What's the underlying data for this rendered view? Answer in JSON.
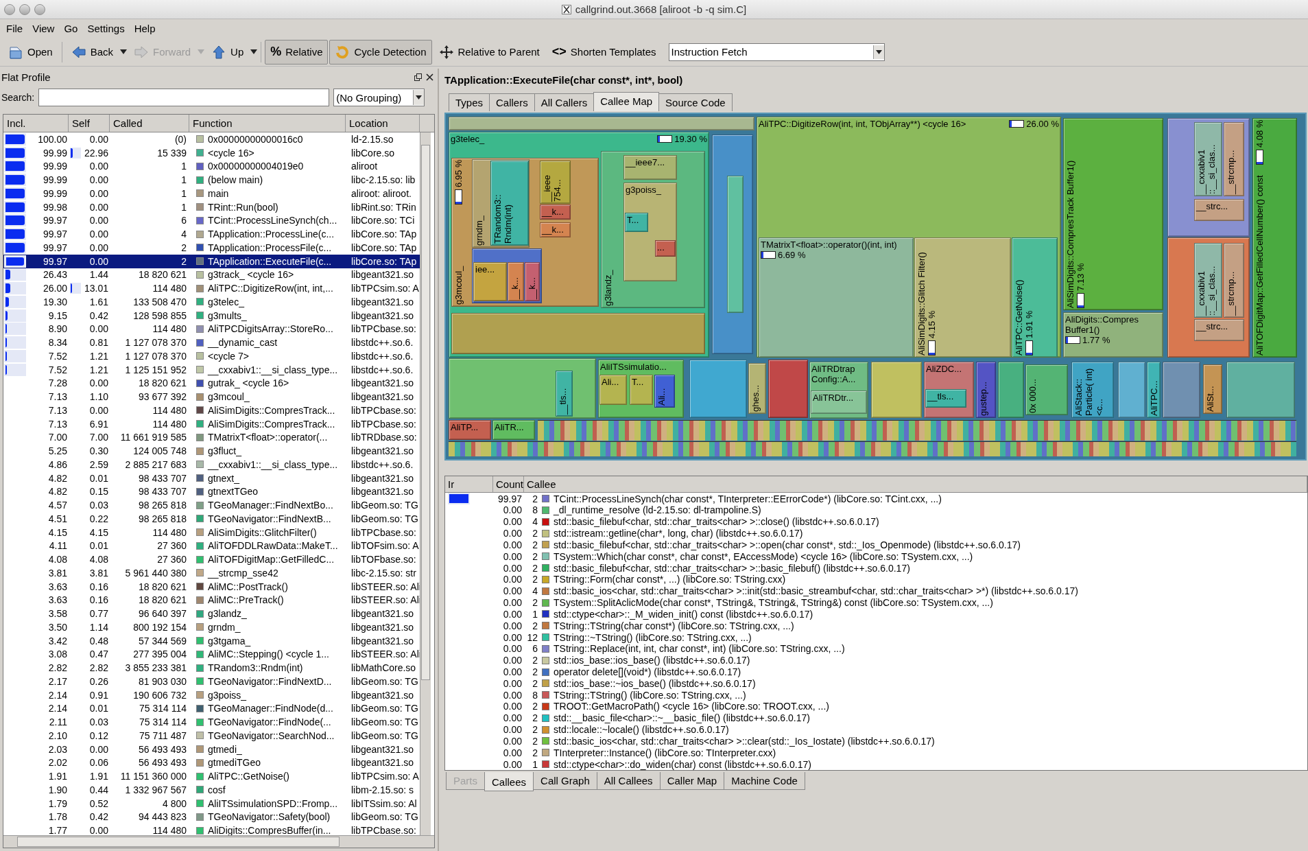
{
  "window": {
    "title": "callgrind.out.3668 [aliroot -b -q sim.C]"
  },
  "menu": [
    "File",
    "View",
    "Go",
    "Settings",
    "Help"
  ],
  "toolbar": {
    "buttons": [
      {
        "label": "Open",
        "kind": "button",
        "disabled": false,
        "checked": false
      },
      {
        "label": "Back",
        "kind": "nav",
        "disabled": false,
        "checked": false
      },
      {
        "label": "Forward",
        "kind": "nav",
        "disabled": true,
        "checked": false
      },
      {
        "label": "Up",
        "kind": "nav",
        "disabled": false,
        "checked": false
      },
      {
        "label": "Relative",
        "kind": "toggle",
        "icon_text": "%",
        "disabled": false,
        "checked": true
      },
      {
        "label": "Cycle Detection",
        "kind": "toggle",
        "disabled": false,
        "checked": true
      },
      {
        "label": "Relative to Parent",
        "kind": "toggle",
        "disabled": false,
        "checked": false
      },
      {
        "label": "Shorten Templates",
        "kind": "toggle",
        "icon_text": "<>",
        "disabled": false,
        "checked": false
      }
    ],
    "event_type": "Instruction Fetch"
  },
  "flat_profile": {
    "title": "Flat Profile",
    "search_label": "Search:",
    "grouping": "(No Grouping)",
    "columns": [
      "Incl.",
      "Self",
      "Called",
      "Function",
      "Location"
    ],
    "rows": [
      {
        "incl": "100.00",
        "level": 1.0,
        "self": "0.00",
        "called": "(0)",
        "function": "0x00000000000016c0",
        "location": "ld-2.15.so",
        "color": "#b8c0a0",
        "selected": false
      },
      {
        "incl": "99.99",
        "level": 0.9999,
        "self": "22.96",
        "self_meter": {
          "level": 0.2296
        },
        "called": "15 339",
        "function": "<cycle 16>",
        "location": "libCore.so",
        "color": "#40b090",
        "selected": false
      },
      {
        "incl": "99.99",
        "level": 0.9999,
        "self": "0.00",
        "called": "1",
        "function": "0x00000000004019e0",
        "location": "aliroot",
        "color": "#6060c0",
        "selected": false
      },
      {
        "incl": "99.99",
        "level": 0.9999,
        "self": "0.00",
        "called": "1",
        "function": "(below main)",
        "location": "libc-2.15.so: lib",
        "color": "#30b080",
        "selected": false
      },
      {
        "incl": "99.99",
        "level": 0.9999,
        "self": "0.00",
        "called": "1",
        "function": "main",
        "location": "aliroot: aliroot.",
        "color": "#a89880",
        "selected": false
      },
      {
        "incl": "99.98",
        "level": 0.9998,
        "self": "0.00",
        "called": "1",
        "function": "TRint::Run(bool)",
        "location": "libRint.so: TRin",
        "color": "#a09080",
        "selected": false
      },
      {
        "incl": "99.97",
        "level": 0.9997,
        "self": "0.00",
        "called": "6",
        "function": "TCint::ProcessLineSynch(ch...",
        "location": "libCore.so: TCi",
        "color": "#6868c8",
        "selected": false
      },
      {
        "incl": "99.97",
        "level": 0.9997,
        "self": "0.00",
        "called": "4",
        "function": "TApplication::ProcessLine(c...",
        "location": "libCore.so: TAp",
        "color": "#b0a890",
        "selected": false
      },
      {
        "incl": "99.97",
        "level": 0.9997,
        "self": "0.00",
        "called": "2",
        "function": "TApplication::ProcessFile(c...",
        "location": "libCore.so: TAp",
        "color": "#3050b0",
        "selected": false
      },
      {
        "incl": "99.97",
        "level": 0.9997,
        "self": "0.00",
        "called": "2",
        "function": "TApplication::ExecuteFile(c...",
        "location": "libCore.so: TAp",
        "color": "#607080",
        "selected": true
      },
      {
        "incl": "26.43",
        "level": 0.2643,
        "self": "1.44",
        "called": "18 820 621",
        "function": "g3track_ <cycle 16>",
        "location": "libgeant321.so",
        "color": "#b8c0a0",
        "selected": false
      },
      {
        "incl": "26.00",
        "level": 0.26,
        "self": "13.01",
        "self_meter": {
          "level": 0.1301
        },
        "called": "114 480",
        "function": "AliTPC::DigitizeRow(int, int,...",
        "location": "libTPCsim.so: A",
        "color": "#a09078",
        "selected": false
      },
      {
        "incl": "19.30",
        "level": 0.193,
        "self": "1.61",
        "called": "133 508 470",
        "function": "g3telec_",
        "location": "libgeant321.so",
        "color": "#30b080",
        "selected": false
      },
      {
        "incl": "9.15",
        "level": 0.0915,
        "self": "0.42",
        "called": "128 598 855",
        "function": "g3mults_",
        "location": "libgeant321.so",
        "color": "#30b080",
        "selected": false
      },
      {
        "incl": "8.90",
        "level": 0.089,
        "self": "0.00",
        "called": "114 480",
        "function": "AliTPCDigitsArray::StoreRo...",
        "location": "libTPCbase.so:",
        "color": "#9090b0",
        "selected": false
      },
      {
        "incl": "8.34",
        "level": 0.0834,
        "self": "0.81",
        "called": "1 127 078 370",
        "function": "__dynamic_cast",
        "location": "libstdc++.so.6.",
        "color": "#5060c0",
        "selected": false
      },
      {
        "incl": "7.52",
        "level": 0.0752,
        "self": "1.21",
        "called": "1 127 078 370",
        "function": "<cycle 7>",
        "location": "libstdc++.so.6.",
        "color": "#b8c0a0",
        "selected": false
      },
      {
        "incl": "7.52",
        "level": 0.0752,
        "self": "1.21",
        "called": "1 125 151 952",
        "function": "__cxxabiv1::__si_class_type...",
        "location": "libstdc++.so.6.",
        "color": "#c0c8a8",
        "selected": false
      },
      {
        "incl": "7.28",
        "self": "0.00",
        "called": "18 820 621",
        "function": "gutrak_ <cycle 16>",
        "location": "libgeant321.so",
        "color": "#4050b0",
        "selected": false
      },
      {
        "incl": "7.13",
        "self": "1.10",
        "called": "93 677 392",
        "function": "g3mcoul_",
        "location": "libgeant321.so",
        "color": "#a89070",
        "selected": false
      },
      {
        "incl": "7.13",
        "self": "0.00",
        "called": "114 480",
        "function": "AliSimDigits::CompresTrack...",
        "location": "libTPCbase.so:",
        "color": "#604848",
        "selected": false
      },
      {
        "incl": "7.13",
        "self": "6.91",
        "called": "114 480",
        "function": "AliSimDigits::CompresTrack...",
        "location": "libTPCbase.so:",
        "color": "#30b080",
        "selected": false
      },
      {
        "incl": "7.00",
        "self": "7.00",
        "called": "11 661 919 585",
        "function": "TMatrixT<float>::operator(...",
        "location": "libTRDbase.so:",
        "color": "#809880",
        "selected": false
      },
      {
        "incl": "5.25",
        "self": "0.30",
        "called": "124 005 748",
        "function": "g3fluct_",
        "location": "libgeant321.so",
        "color": "#b09878",
        "selected": false
      },
      {
        "incl": "4.86",
        "self": "2.59",
        "called": "2 885 217 683",
        "function": "__cxxabiv1::__si_class_type...",
        "location": "libstdc++.so.6.",
        "color": "#a8b8a8",
        "selected": false
      },
      {
        "incl": "4.82",
        "self": "0.01",
        "called": "98 433 707",
        "function": "gtnext_",
        "location": "libgeant321.so",
        "color": "#506080",
        "selected": false
      },
      {
        "incl": "4.82",
        "self": "0.15",
        "called": "98 433 707",
        "function": "gtnextTGeo",
        "location": "libgeant321.so",
        "color": "#506080",
        "selected": false
      },
      {
        "incl": "4.57",
        "self": "0.03",
        "called": "98 265 818",
        "function": "TGeoManager::FindNextBo...",
        "location": "libGeom.so: TG",
        "color": "#80a088",
        "selected": false
      },
      {
        "incl": "4.51",
        "self": "0.22",
        "called": "98 265 818",
        "function": "TGeoNavigator::FindNextB...",
        "location": "libGeom.so: TG",
        "color": "#30a878",
        "selected": false
      },
      {
        "incl": "4.15",
        "self": "4.15",
        "called": "114 480",
        "function": "AliSimDigits::GlitchFilter()",
        "location": "libTPCbase.so:",
        "color": "#b8a080",
        "selected": false
      },
      {
        "incl": "4.11",
        "self": "0.01",
        "called": "27 360",
        "function": "AliTOFDDLRawData::MakeT...",
        "location": "libTOFsim.so: A",
        "color": "#30b080",
        "selected": false
      },
      {
        "incl": "4.08",
        "self": "4.08",
        "called": "27 360",
        "function": "AliTOFDigitMap::GetFilledC...",
        "location": "libTOFbase.so:",
        "color": "#30c070",
        "selected": false
      },
      {
        "incl": "3.81",
        "self": "3.81",
        "called": "5 961 440 380",
        "function": "__strcmp_sse42",
        "location": "libc-2.15.so: str",
        "color": "#c0a888",
        "selected": false
      },
      {
        "incl": "3.63",
        "self": "0.16",
        "called": "18 820 621",
        "function": "AliMC::PostTrack()",
        "location": "libSTEER.so: Ali",
        "color": "#604840",
        "selected": false
      },
      {
        "incl": "3.63",
        "self": "0.16",
        "called": "18 820 621",
        "function": "AliMC::PreTrack()",
        "location": "libSTEER.so: Ali",
        "color": "#a08870",
        "selected": false
      },
      {
        "incl": "3.58",
        "self": "0.77",
        "called": "96 640 397",
        "function": "g3landz_",
        "location": "libgeant321.so",
        "color": "#30a880",
        "selected": false
      },
      {
        "incl": "3.50",
        "self": "1.14",
        "called": "800 192 154",
        "function": "grndm_",
        "location": "libgeant321.so",
        "color": "#b8a080",
        "selected": false
      },
      {
        "incl": "3.42",
        "self": "0.48",
        "called": "57 344 569",
        "function": "g3tgama_",
        "location": "libgeant321.so",
        "color": "#30c070",
        "selected": false
      },
      {
        "incl": "3.08",
        "self": "0.47",
        "called": "277 395 004",
        "function": "AliMC::Stepping() <cycle 1...",
        "location": "libSTEER.so: Ali",
        "color": "#30b878",
        "selected": false
      },
      {
        "incl": "2.82",
        "self": "2.82",
        "called": "3 855 233 381",
        "function": "TRandom3::Rndm(int)",
        "location": "libMathCore.so",
        "color": "#30b080",
        "selected": false
      },
      {
        "incl": "2.17",
        "self": "0.26",
        "called": "81 903 030",
        "function": "TGeoNavigator::FindNextD...",
        "location": "libGeom.so: TG",
        "color": "#30c070",
        "selected": false
      },
      {
        "incl": "2.14",
        "self": "0.91",
        "called": "190 606 732",
        "function": "g3poiss_",
        "location": "libgeant321.so",
        "color": "#b8a080",
        "selected": false
      },
      {
        "incl": "2.14",
        "self": "0.01",
        "called": "75 314 114",
        "function": "TGeoManager::FindNode(d...",
        "location": "libGeom.so: TG",
        "color": "#406070",
        "selected": false
      },
      {
        "incl": "2.11",
        "self": "0.03",
        "called": "75 314 114",
        "function": "TGeoNavigator::FindNode(...",
        "location": "libGeom.so: TG",
        "color": "#30c070",
        "selected": false
      },
      {
        "incl": "2.10",
        "self": "0.12",
        "called": "75 711 487",
        "function": "TGeoNavigator::SearchNod...",
        "location": "libGeom.so: TG",
        "color": "#c0c0a8",
        "selected": false
      },
      {
        "incl": "2.03",
        "self": "0.00",
        "called": "56 493 493",
        "function": "gtmedi_",
        "location": "libgeant321.so",
        "color": "#b09878",
        "selected": false
      },
      {
        "incl": "2.02",
        "self": "0.06",
        "called": "56 493 493",
        "function": "gtmediTGeo",
        "location": "libgeant321.so",
        "color": "#b09878",
        "selected": false
      },
      {
        "incl": "1.91",
        "self": "1.91",
        "called": "11 151 360 000",
        "function": "AliTPC::GetNoise()",
        "location": "libTPCsim.so: A",
        "color": "#30c070",
        "selected": false
      },
      {
        "incl": "1.90",
        "self": "0.44",
        "called": "1 332 967 567",
        "function": "cosf",
        "location": "libm-2.15.so: s",
        "color": "#30a878",
        "selected": false
      },
      {
        "incl": "1.79",
        "self": "0.52",
        "called": "4 800",
        "function": "AliITSsimulationSPD::Fromp...",
        "location": "libITSsim.so: Al",
        "color": "#30c070",
        "selected": false
      },
      {
        "incl": "1.78",
        "self": "0.42",
        "called": "94 443 823",
        "function": "TGeoNavigator::Safety(bool)",
        "location": "libGeom.so: TG",
        "color": "#809888",
        "selected": false
      },
      {
        "incl": "1.77",
        "self": "0.00",
        "called": "114 480",
        "function": "AliDigits::CompresBuffer(in...",
        "location": "libTPCbase.so:",
        "color": "#30c070",
        "selected": false
      }
    ]
  },
  "detail": {
    "title": "TApplication::ExecuteFile(char const*, int*, bool)",
    "tabs": [
      {
        "label": "Types",
        "selected": false
      },
      {
        "label": "Callers",
        "selected": false
      },
      {
        "label": "All Callers",
        "selected": false
      },
      {
        "label": "Callee Map",
        "selected": true
      },
      {
        "label": "Source Code",
        "selected": false
      }
    ],
    "callee_map": {
      "nodes": [
        {
          "label": "g3telec_",
          "percent": "19.30 %",
          "kind": "horizontal",
          "color": "#3cb88c",
          "children": [
            {
              "label": "g3mcoul_",
              "percent": "6.95 %",
              "kind": "vertical",
              "color": "#c09858",
              "children": [
                {
                  "label": "grndm_",
                  "kind": "vertical",
                  "color": "#b4a470",
                  "children": [
                    {
                      "label": "TRandom3:: Rndm(int)",
                      "kind": "vertical",
                      "color": "#40b4a4"
                    }
                  ]
                },
                {
                  "label": "__ieee 754...",
                  "kind": "vertical",
                  "color": "#b4a840"
                },
                {
                  "label": "__k...",
                  "kind": "horizontal",
                  "color": "#c46050"
                },
                {
                  "label": "__k...",
                  "kind": "horizontal",
                  "color": "#d48450"
                },
                {
                  "color": "#5070c8",
                  "children": [
                    {
                      "label": "iee...",
                      "kind": "horizontal",
                      "color": "#c4a440"
                    },
                    {
                      "label": "__k...",
                      "kind": "vertical",
                      "color": "#d48450"
                    },
                    {
                      "label": "__k...",
                      "kind": "vertical",
                      "color": "#c46070"
                    }
                  ]
                }
              ]
            },
            {
              "label": "g3landz_",
              "kind": "vertical",
              "color": "#5cb880",
              "children": [
                {
                  "label": "__ieee7...",
                  "kind": "horizontal",
                  "color": "#a8b470"
                },
                {
                  "label": "g3poiss_",
                  "kind": "horizontal",
                  "color": "#b8b474",
                  "children": [
                    {
                      "label": "T...",
                      "kind": "horizontal",
                      "color": "#40b4a4"
                    },
                    {
                      "label": "...",
                      "kind": "horizontal",
                      "color": "#c46050"
                    }
                  ]
                }
              ]
            },
            {
              "color": "#b0a050"
            }
          ]
        },
        {
          "color": "#a8b890"
        },
        {
          "color": "#4890c8",
          "children": [
            {
              "color": "#60c0a0"
            }
          ]
        },
        {
          "label": "AliTPC::DigitizeRow(int, int, TObjArray**) <cycle 16>",
          "percent": "26.00 %",
          "kind": "horizontal",
          "color": "#8cba5c",
          "children": [
            {
              "label": "TMatrixT<float>::operator()(int, int)",
              "percent": "6.69 %",
              "kind": "horizontal",
              "color": "#8eb89c"
            },
            {
              "label": "AliSimDigits::Glitch Filter()",
              "percent": "4.15 %",
              "kind": "vertical",
              "color": "#bab87c"
            },
            {
              "label": "AliTPC::GetNoise()",
              "percent": "1.91 %",
              "kind": "vertical",
              "color": "#4cbc98"
            }
          ]
        },
        {
          "label": "AliSimDigits::CompresTrack Buffer1()",
          "percent": "7.13 %",
          "kind": "vertical",
          "color": "#5cb040"
        },
        {
          "label": "AliDigits::Compres Buffer1()",
          "percent": "1.77 %",
          "kind": "horizontal",
          "color": "#90b27c"
        },
        {
          "color": "#8890d0",
          "children": [
            {
              "label": "__cxxabiv1 ::__si_clas...",
              "kind": "vertical",
              "color": "#8fb8a8"
            },
            {
              "label": "__strcmp...",
              "kind": "vertical",
              "color": "#c4a084"
            },
            {
              "label": "__strc...",
              "kind": "horizontal",
              "color": "#c4a084"
            }
          ]
        },
        {
          "color": "#d87850",
          "children": [
            {
              "label": "__cxxabiv1 ::__si_clas...",
              "kind": "vertical",
              "color": "#8fb8a8"
            },
            {
              "label": "__strcmp...",
              "kind": "vertical",
              "color": "#c4a084"
            },
            {
              "label": "__strc...",
              "kind": "horizontal",
              "color": "#c4a084"
            }
          ]
        },
        {
          "label": "AliTOFDigitMap::GetFilledCellNumber() const",
          "percent": "4.08 %",
          "kind": "vertical",
          "color": "#4aaa40"
        },
        {
          "color": "#70c070",
          "children": [
            {
              "label": "__tls...",
              "kind": "vertical",
              "color": "#40b4a4"
            }
          ]
        },
        {
          "label": "AliITSsimulatio...",
          "kind": "horizontal",
          "color": "#60bc60",
          "children": [
            {
              "label": "Ali...",
              "kind": "horizontal",
              "color": "#b4b450"
            },
            {
              "label": "T...",
              "kind": "horizontal",
              "color": "#b4b450"
            },
            {
              "label": "Ali...",
              "kind": "vertical",
              "color": "#4060d4"
            }
          ]
        },
        {
          "color": "#40a8d0"
        },
        {
          "label": "ghes...",
          "kind": "vertical",
          "color": "#b4b474"
        },
        {
          "color": "#c04848"
        },
        {
          "label": "AliTRDtrap Config::A...",
          "kind": "horizontal",
          "color": "#70bc84",
          "children": [
            {
              "label": "AliTRDtr...",
              "kind": "horizontal",
              "color": "#88c498"
            }
          ]
        },
        {
          "color": "#c0c060"
        },
        {
          "label": "AliZDC...",
          "kind": "horizontal",
          "color": "#c47474",
          "children": [
            {
              "label": "__tls...",
              "kind": "horizontal",
              "color": "#40b4a4"
            }
          ]
        },
        {
          "label": "gustep...",
          "kind": "vertical",
          "color": "#5454c4"
        },
        {
          "color": "#48b080"
        },
        {
          "label": "0x 000...",
          "kind": "vertical",
          "color": "#54b474"
        },
        {
          "label": "AliStack:: Particle( int) <c...",
          "kind": "vertical",
          "color": "#40a4c4"
        },
        {
          "color": "#60b0d0"
        },
        {
          "label": "AliTPC...",
          "kind": "vertical",
          "color": "#40b4b4"
        },
        {
          "color": "#7090b0"
        },
        {
          "label": "AliSt...",
          "kind": "vertical",
          "color": "#c49454"
        },
        {
          "color": "#60b0a0"
        },
        {
          "label": "AliTP...",
          "kind": "horizontal",
          "color": "#c46050"
        },
        {
          "label": "AliTR...",
          "kind": "horizontal",
          "color": "#60bc60"
        }
      ]
    },
    "callees": {
      "columns": [
        "Ir",
        "Count",
        "Callee"
      ],
      "rows": [
        {
          "ir": "99.97",
          "level": 0.9997,
          "count": "2",
          "callee": "TCint::ProcessLineSynch(char const*, TInterpreter::EErrorCode*) (libCore.so: TCint.cxx, ...)",
          "color": "#7070c8"
        },
        {
          "ir": "0.00",
          "count": "8",
          "callee": "_dl_runtime_resolve (ld-2.15.so: dl-trampoline.S)",
          "color": "#50b870"
        },
        {
          "ir": "0.00",
          "count": "4",
          "callee": "std::basic_filebuf<char, std::char_traits<char> >::close() (libstdc++.so.6.0.17)",
          "color": "#c81010"
        },
        {
          "ir": "0.00",
          "count": "2",
          "callee": "std::istream::getline(char*, long, char) (libstdc++.so.6.0.17)",
          "color": "#c0c080"
        },
        {
          "ir": "0.00",
          "count": "2",
          "callee": "std::basic_filebuf<char, std::char_traits<char> >::open(char const*, std::_Ios_Openmode) (libstdc++.so.6.0.17)",
          "color": "#c0a050"
        },
        {
          "ir": "0.00",
          "count": "2",
          "callee": "TSystem::Which(char const*, char const*, EAccessMode) <cycle 16> (libCore.so: TSystem.cxx, ...)",
          "color": "#80c0b0"
        },
        {
          "ir": "0.00",
          "count": "2",
          "callee": "std::basic_filebuf<char, std::char_traits<char> >::basic_filebuf() (libstdc++.so.6.0.17)",
          "color": "#30b060"
        },
        {
          "ir": "0.00",
          "count": "2",
          "callee": "TString::Form(char const*, ...) (libCore.so: TString.cxx)",
          "color": "#c8a828"
        },
        {
          "ir": "0.00",
          "count": "4",
          "callee": "std::basic_ios<char, std::char_traits<char> >::init(std::basic_streambuf<char, std::char_traits<char> >*) (libstdc++.so.6.0.17)",
          "color": "#c07840"
        },
        {
          "ir": "0.00",
          "count": "2",
          "callee": "TSystem::SplitAclicMode(char const*, TString&, TString&, TString&) const (libCore.so: TSystem.cxx, ...)",
          "color": "#60b850"
        },
        {
          "ir": "0.00",
          "count": "1",
          "callee": "std::ctype<char>::_M_widen_init() const (libstdc++.so.6.0.17)",
          "color": "#2030c0"
        },
        {
          "ir": "0.00",
          "count": "2",
          "callee": "TString::TString(char const*) (libCore.so: TString.cxx, ...)",
          "color": "#c07840"
        },
        {
          "ir": "0.00",
          "count": "12",
          "callee": "TString::~TString() (libCore.so: TString.cxx, ...)",
          "color": "#30c0a0"
        },
        {
          "ir": "0.00",
          "count": "6",
          "callee": "TString::Replace(int, int, char const*, int) (libCore.so: TString.cxx, ...)",
          "color": "#8080c8"
        },
        {
          "ir": "0.00",
          "count": "2",
          "callee": "std::ios_base::ios_base() (libstdc++.so.6.0.17)",
          "color": "#c8c8a0"
        },
        {
          "ir": "0.00",
          "count": "2",
          "callee": "operator delete[](void*) (libstdc++.so.6.0.17)",
          "color": "#4070c0"
        },
        {
          "ir": "0.00",
          "count": "2",
          "callee": "std::ios_base::~ios_base() (libstdc++.so.6.0.17)",
          "color": "#c0a048"
        },
        {
          "ir": "0.00",
          "count": "8",
          "callee": "TString::TString() (libCore.so: TString.cxx, ...)",
          "color": "#c85858"
        },
        {
          "ir": "0.00",
          "count": "2",
          "callee": "TROOT::GetMacroPath() <cycle 16> (libCore.so: TROOT.cxx, ...)",
          "color": "#c83818"
        },
        {
          "ir": "0.00",
          "count": "2",
          "callee": "std::__basic_file<char>::~__basic_file() (libstdc++.so.6.0.17)",
          "color": "#20c0c0"
        },
        {
          "ir": "0.00",
          "count": "2",
          "callee": "std::locale::~locale() (libstdc++.so.6.0.17)",
          "color": "#d09030"
        },
        {
          "ir": "0.00",
          "count": "2",
          "callee": "std::basic_ios<char, std::char_traits<char> >::clear(std::_Ios_Iostate) (libstdc++.so.6.0.17)",
          "color": "#70c040"
        },
        {
          "ir": "0.00",
          "count": "2",
          "callee": "TInterpreter::Instance() (libCore.so: TInterpreter.cxx)",
          "color": "#c0a880"
        },
        {
          "ir": "0.00",
          "count": "1",
          "callee": "std::ctype<char>::do_widen(char) const (libstdc++.so.6.0.17)",
          "color": "#c83838"
        }
      ]
    },
    "bottom_tabs": [
      {
        "label": "Parts",
        "selected": false,
        "disabled": true
      },
      {
        "label": "Callees",
        "selected": true,
        "disabled": false
      },
      {
        "label": "Call Graph",
        "selected": false,
        "disabled": false
      },
      {
        "label": "All Callees",
        "selected": false,
        "disabled": false
      },
      {
        "label": "Caller Map",
        "selected": false,
        "disabled": false
      },
      {
        "label": "Machine Code",
        "selected": false,
        "disabled": false
      }
    ]
  }
}
